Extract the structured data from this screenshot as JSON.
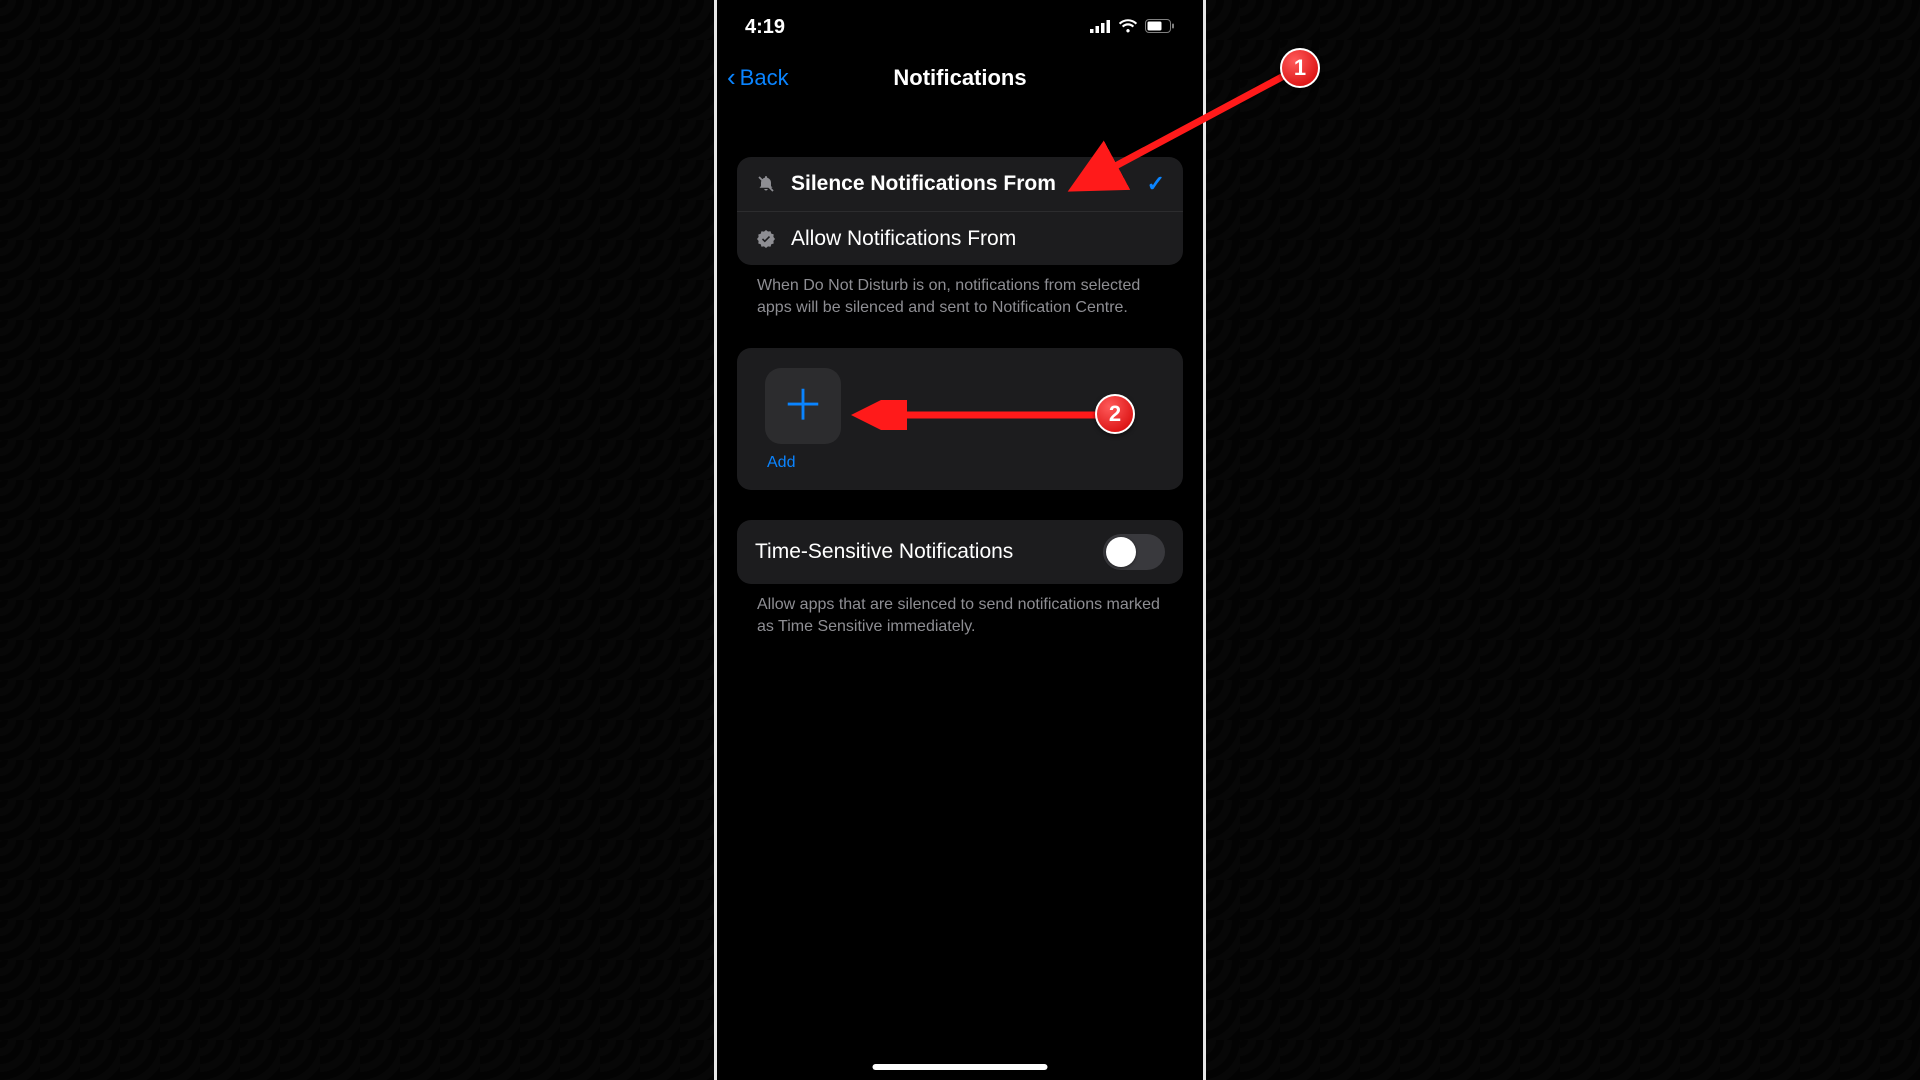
{
  "status": {
    "time": "4:19"
  },
  "nav": {
    "back": "Back",
    "title": "Notifications"
  },
  "options": {
    "silence": {
      "label": "Silence Notifications From",
      "selected": true
    },
    "allow": {
      "label": "Allow Notifications From",
      "selected": false
    },
    "footer": "When Do Not Disturb is on, notifications from selected apps will be silenced and sent to Notification Centre."
  },
  "add": {
    "label": "Add"
  },
  "timeSensitive": {
    "label": "Time-Sensitive Notifications",
    "enabled": false,
    "footer": "Allow apps that are silenced to send notifications marked as Time Sensitive immediately."
  },
  "annotations": {
    "b1": "1",
    "b2": "2"
  }
}
